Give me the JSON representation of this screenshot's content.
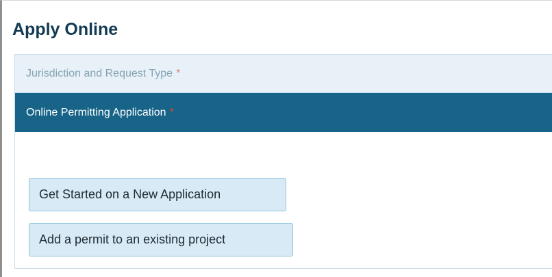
{
  "page": {
    "title": "Apply Online"
  },
  "steps": [
    {
      "label": "Jurisdiction and Request Type",
      "required_marker": "*",
      "state": "inactive"
    },
    {
      "label": "Online Permitting Application",
      "required_marker": "*",
      "state": "active"
    }
  ],
  "actions": {
    "new_application_label": "Get Started on a New Application",
    "add_permit_label": "Add a permit to an existing project"
  },
  "colors": {
    "title": "#123a52",
    "active_step_bg": "#176488",
    "inactive_step_bg": "#e7f1f7",
    "required": "#e0462f",
    "button_bg": "#d7eaf5",
    "button_border": "#8fc2dc"
  }
}
